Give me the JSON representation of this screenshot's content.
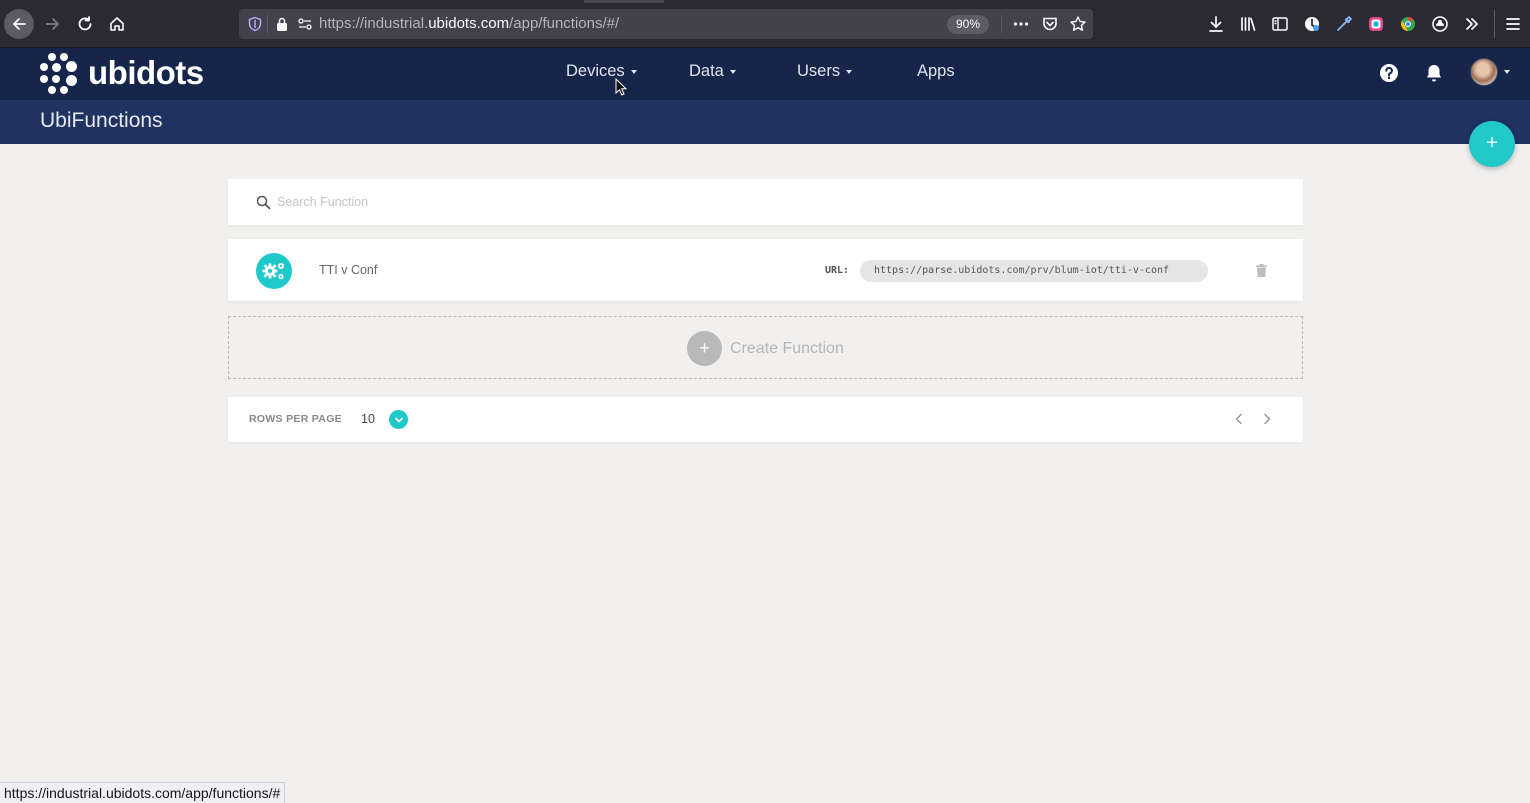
{
  "browser": {
    "url_prefix": "https://industrial.",
    "url_host": "ubidots.com",
    "url_path": "/app/functions/#/",
    "zoom": "90%",
    "status_url": "https://industrial.ubidots.com/app/functions/#"
  },
  "header": {
    "logo_text": "ubidots",
    "menu": [
      {
        "label": "Devices",
        "has_caret": true
      },
      {
        "label": "Data",
        "has_caret": true
      },
      {
        "label": "Users",
        "has_caret": true
      },
      {
        "label": "Apps",
        "has_caret": false
      }
    ]
  },
  "page": {
    "title": "UbiFunctions",
    "fab_label": "+"
  },
  "search": {
    "placeholder": "Search Function"
  },
  "functions": [
    {
      "name": "TTI v Conf",
      "url_label": "URL:",
      "url": "https://parse.ubidots.com/prv/blum-iot/tti-v-conf"
    }
  ],
  "create": {
    "plus": "+",
    "label": "Create Function"
  },
  "pagination": {
    "rows_label": "ROWS PER PAGE",
    "rows_value": "10"
  },
  "colors": {
    "accent": "#22c9c9",
    "nav_bg": "#16254a",
    "subheader_bg": "#1f3260",
    "page_bg": "#f1f0ef"
  }
}
